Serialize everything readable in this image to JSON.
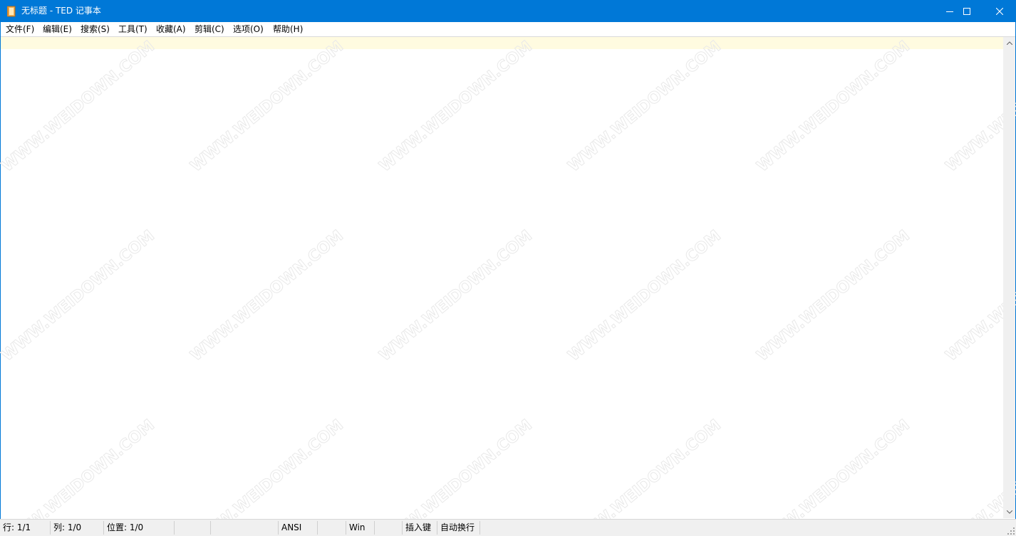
{
  "window": {
    "title": "无标题 - TED 记事本",
    "accent_color": "#0078d7",
    "controls": {
      "minimize_icon": "minimize-icon",
      "maximize_icon": "maximize-icon",
      "close_icon": "close-icon"
    }
  },
  "menu": {
    "items": [
      {
        "label": "文件(F)"
      },
      {
        "label": "编辑(E)"
      },
      {
        "label": "搜索(S)"
      },
      {
        "label": "工具(T)"
      },
      {
        "label": "收藏(A)"
      },
      {
        "label": "剪辑(C)"
      },
      {
        "label": "选项(O)"
      },
      {
        "label": "帮助(H)"
      }
    ]
  },
  "editor": {
    "content": "",
    "current_line_color": "#fffbe0"
  },
  "status": {
    "line": "行: 1/1",
    "column": "列: 1/0",
    "position": "位置: 1/0",
    "blank1": "",
    "blank2": "",
    "encoding": "ANSI",
    "blank3": "",
    "line_ending": "Win",
    "blank4": "",
    "insert_mode": "插入键",
    "word_wrap": "自动换行"
  },
  "watermark": {
    "text": "WWW.WEIDOWN.COM"
  }
}
